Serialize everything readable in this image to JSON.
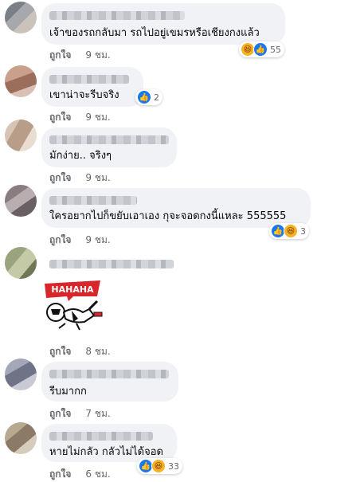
{
  "comments": [
    {
      "text": "เจ้าของรถกลับมา รถไปอยู่เขมรหรือเชียงกงแล้ว",
      "reactions": {
        "icons": [
          "haha",
          "like"
        ],
        "count": "55"
      },
      "like_label": "ถูกใจ",
      "time": "9 ชม."
    },
    {
      "text": "เขาน่าจะรีบจริง",
      "reactions": {
        "icons": [
          "like"
        ],
        "count": "2"
      },
      "like_label": "ถูกใจ",
      "time": "9 ชม."
    },
    {
      "text": "มักง่าย.. จริงๆ",
      "like_label": "ถูกใจ",
      "time": "9 ชม."
    },
    {
      "text": "ใครอยากไปก็ขยับเอาเอง กุจะจอดกงนี้แหละ 555555",
      "reactions": {
        "icons": [
          "like",
          "haha"
        ],
        "count": "3"
      },
      "like_label": "ถูกใจ",
      "time": "9 ชม."
    },
    {
      "sticker": "haha-sticker",
      "sticker_text": "HAHAHA",
      "like_label": "ถูกใจ",
      "time": "8 ชม."
    },
    {
      "text": "รีบมากก",
      "like_label": "ถูกใจ",
      "time": "7 ชม."
    },
    {
      "text": "หายไม่กลัว กลัวไม่ได้จอด",
      "reactions": {
        "icons": [
          "like",
          "haha"
        ],
        "count": "33"
      },
      "like_label": "ถูกใจ",
      "time": "6 ชม."
    }
  ],
  "colors": {
    "bubble": "#f0f2f5",
    "like": "#1877f2",
    "haha": "#f7b125",
    "meta": "#65676b"
  }
}
